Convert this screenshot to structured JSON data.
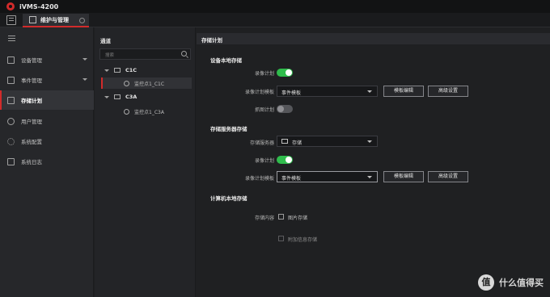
{
  "app": {
    "title": "iVMS-4200"
  },
  "tabs": [
    {
      "label": "维护与管理"
    }
  ],
  "sidebar": {
    "items": [
      {
        "label": "设备管理",
        "icon": "device-icon",
        "expandable": true
      },
      {
        "label": "事件管理",
        "icon": "event-icon",
        "expandable": true
      },
      {
        "label": "存储计划",
        "icon": "storage-icon",
        "active": true
      },
      {
        "label": "用户管理",
        "icon": "user-icon"
      },
      {
        "label": "系统配置",
        "icon": "gear-icon"
      },
      {
        "label": "系统日志",
        "icon": "log-icon"
      }
    ]
  },
  "channel_panel": {
    "title": "通道",
    "search_placeholder": "搜索",
    "groups": [
      {
        "name": "C1C",
        "cameras": [
          {
            "name": "监控点1_C1C",
            "selected": true
          }
        ]
      },
      {
        "name": "C3A",
        "cameras": [
          {
            "name": "监控点1_C3A"
          }
        ]
      }
    ]
  },
  "main": {
    "title": "存储计划",
    "device_local": {
      "heading": "设备本地存储",
      "record_schedule_label": "录像计划",
      "record_schedule_on": true,
      "record_template_label": "录像计划模板",
      "record_template_value": "事件模板",
      "template_edit_button": "模板编辑",
      "advanced_button": "高级设置",
      "capture_schedule_label": "抓图计划",
      "capture_schedule_on": false
    },
    "storage_server": {
      "heading": "存储服务器存储",
      "server_label": "存储服务器",
      "server_value": "存储",
      "record_schedule_label": "录像计划",
      "record_schedule_on": true,
      "record_template_label": "录像计划模板",
      "record_template_value": "事件模板",
      "template_edit_button": "模板编辑",
      "advanced_button": "高级设置"
    },
    "pc_local": {
      "heading": "计算机本地存储",
      "content_label": "存储内容",
      "picture_storage_label": "图片存储",
      "picture_storage_checked": false,
      "extra_info_label": "附加信息存储",
      "extra_info_checked": false,
      "extra_info_disabled": true
    }
  },
  "watermark": {
    "badge": "值",
    "text": "什么值得买"
  },
  "colors": {
    "accent": "#d22b2b",
    "toggle_on": "#2fbc4c"
  }
}
